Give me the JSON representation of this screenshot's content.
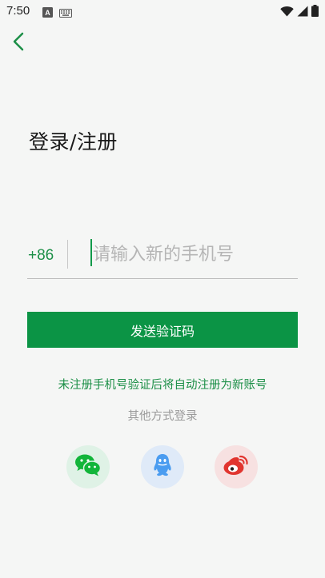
{
  "status_bar": {
    "time": "7:50",
    "icons": [
      "a-keyboard-notification-icon",
      "keyboard-icon",
      "wifi-icon",
      "cellular-signal-icon",
      "battery-icon"
    ]
  },
  "header": {
    "back_icon": "chevron-left-icon"
  },
  "title": "登录/注册",
  "phone": {
    "country_code": "+86",
    "placeholder": "请输入新的手机号",
    "value": ""
  },
  "send_code_button": "发送验证码",
  "register_hint": "未注册手机号验证后将自动注册为新账号",
  "other_login": {
    "title": "其他方式登录",
    "options": [
      {
        "icon": "wechat-icon",
        "color": "#12b53a"
      },
      {
        "icon": "qq-icon",
        "color": "#4a9cf0"
      },
      {
        "icon": "weibo-icon",
        "color": "#e1352f"
      }
    ]
  },
  "colors": {
    "accent": "#0b9445",
    "background": "#f5f6f5"
  }
}
